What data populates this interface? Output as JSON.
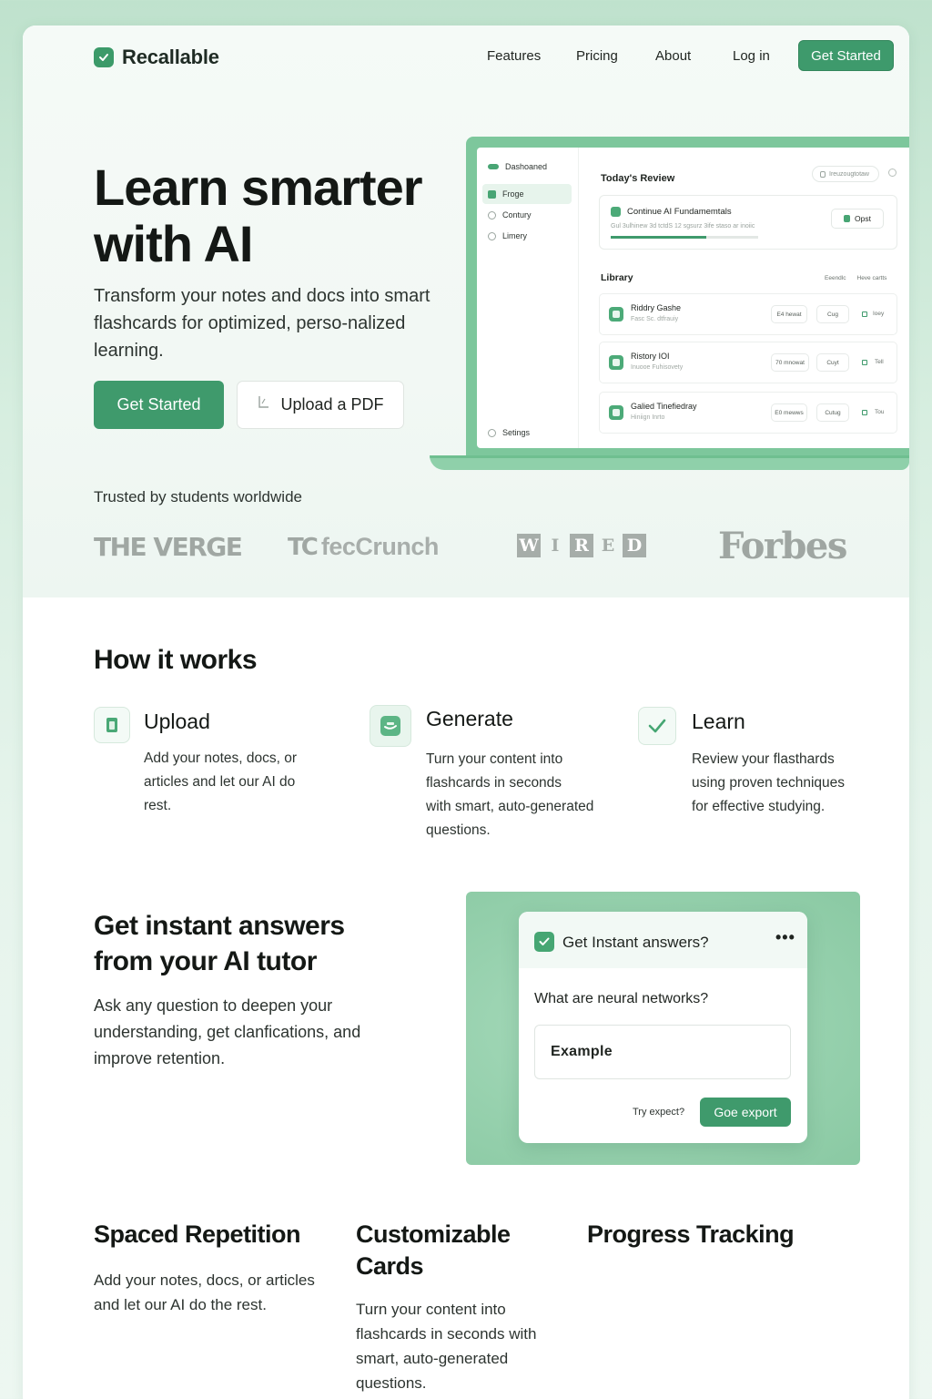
{
  "brand": {
    "name": "Recallable"
  },
  "nav": {
    "links": [
      "Features",
      "Pricing",
      "About",
      "Log in"
    ],
    "cta": "Get Started"
  },
  "hero": {
    "title_line1": "Learn smarter",
    "title_line2": "with AI",
    "subtitle": "Transform your notes and docs into smart flashcards for optimized, perso-nalized learning.",
    "primary_button": "Get Started",
    "secondary_button": "Upload a PDF"
  },
  "mock": {
    "sidebar": [
      {
        "label": "Dashoaned",
        "icon": "dashboard-icon"
      },
      {
        "label": "Froge",
        "icon": "cards-icon",
        "active": true
      },
      {
        "label": "Contury",
        "icon": "search-icon"
      },
      {
        "label": "Limery",
        "icon": "search-icon"
      }
    ],
    "settings": "Setings",
    "today_title": "Today's Review",
    "search_placeholder": "Ireuzougtotaw",
    "review_card": {
      "title": "Continue AI Fundamemtals",
      "subtitle": "Gul 3ulhinew 3d tctdS 12 sgsurz 3ife staso ar inoiic",
      "progress": 0.65,
      "button": "Opst"
    },
    "library_title": "Library",
    "library_tools": [
      "Eeendlc",
      "Heve cartts"
    ],
    "rows": [
      {
        "title": "Riddry Gashe",
        "subtitle": "Fasc Sc. dtfrauiy",
        "pill1": "E4 hewat",
        "pill2": "Cug",
        "tag": "Ioey"
      },
      {
        "title": "Ristory IOI",
        "subtitle": "Inuooe Fuhisovety",
        "pill1": "70 mnowat",
        "pill2": "Cuyt",
        "tag": "Tell"
      },
      {
        "title": "Galied Tinefiedray",
        "subtitle": "Hiniign Inrto",
        "pill1": "E0 mewws",
        "pill2": "Cutug",
        "tag": "Tou"
      }
    ]
  },
  "trusted": {
    "label": "Trusted by students worldwide",
    "logos": [
      "THE VERGE",
      "TechCrunch",
      "WIRED",
      "Forbes"
    ],
    "tc_mark": "TC",
    "tc_word": "fecCrunch",
    "wired_letters": [
      "W",
      "I",
      "R",
      "E",
      "D"
    ]
  },
  "how": {
    "title": "How it works",
    "steps": [
      {
        "title": "Upload",
        "text_lines": [
          "Add your notes, docs, or",
          "articles and let our AI do",
          "rest."
        ],
        "icon": "document-icon"
      },
      {
        "title": "Generate",
        "text_lines": [
          "Turn your content into",
          "flashcards in seconds",
          "with smart, auto-generated",
          "questions."
        ],
        "icon": "cards-icon"
      },
      {
        "title": "Learn",
        "text_lines": [
          "Review your flasthards",
          "using proven techniques",
          "for effective studying."
        ],
        "icon": "check-icon"
      }
    ]
  },
  "ai": {
    "title_line1": "Get instant answers",
    "title_line2": "from your AI tutor",
    "text": "Ask any question to deepen your understanding, get clanfications, and improve retention.",
    "chat": {
      "title": "Get Instant answers?",
      "menu": "•••",
      "question": "What are neural networks?",
      "input_value": "Example",
      "hint": "Try expect?",
      "button": "Goe export"
    }
  },
  "features": [
    {
      "title": "Spaced Repetition",
      "text": "Add your notes, docs, or articles and let our AI do the rest."
    },
    {
      "title_line1": "Customizable",
      "title_line2": "Cards",
      "text": "Turn your content into flashcards in seconds with smart, auto-generated questions."
    },
    {
      "title": "Progress Tracking",
      "text": ""
    }
  ],
  "colors": {
    "accent": "#3f9a6c",
    "accent_light": "#97d1ae",
    "background": "#d7eee0"
  }
}
